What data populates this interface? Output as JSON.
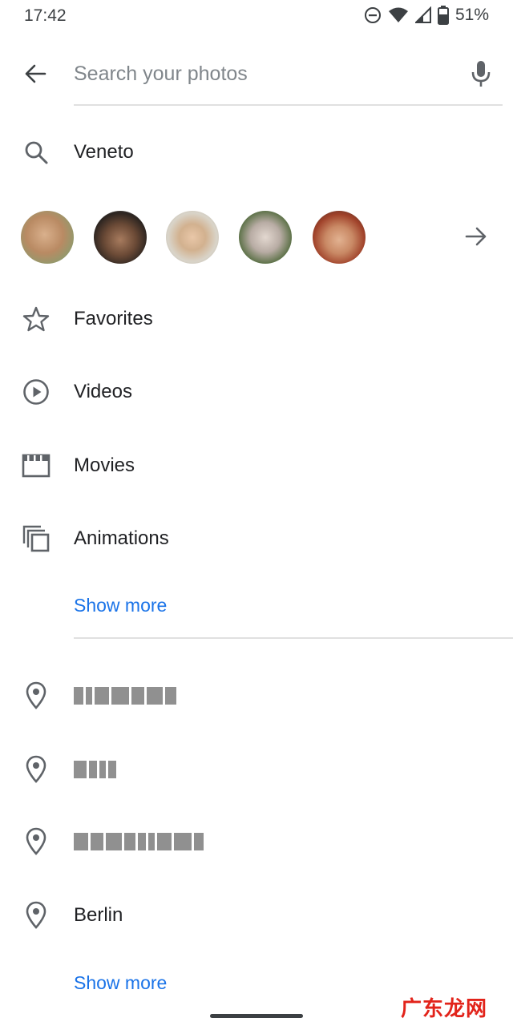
{
  "status_bar": {
    "time": "17:42",
    "battery_pct": "51%",
    "icons": [
      "dnd-icon",
      "wifi-icon",
      "signal-icon",
      "battery-icon"
    ]
  },
  "search": {
    "placeholder": "Search your photos",
    "back_icon": "arrow-left-icon",
    "mic_icon": "mic-icon"
  },
  "suggestion": {
    "icon": "search-icon",
    "label": "Veneto"
  },
  "people": {
    "avatars": [
      "person-1",
      "person-2",
      "person-3",
      "person-4",
      "person-5"
    ],
    "more_icon": "arrow-right-icon"
  },
  "categories": [
    {
      "icon": "star-icon",
      "label": "Favorites"
    },
    {
      "icon": "play-circle-icon",
      "label": "Videos"
    },
    {
      "icon": "movie-icon",
      "label": "Movies"
    },
    {
      "icon": "animation-icon",
      "label": "Animations"
    }
  ],
  "categories_show_more": "Show more",
  "places": [
    {
      "icon": "place-pin-icon",
      "label": "",
      "redacted": true
    },
    {
      "icon": "place-pin-icon",
      "label": "",
      "redacted": true
    },
    {
      "icon": "place-pin-icon",
      "label": "",
      "redacted": true
    },
    {
      "icon": "place-pin-icon",
      "label": "Berlin",
      "redacted": false
    }
  ],
  "places_show_more": "Show more",
  "watermark": "广东龙网",
  "colors": {
    "accent": "#1a73e8",
    "icon": "#5f6368",
    "text": "#202124",
    "divider": "#e0e0e0"
  }
}
